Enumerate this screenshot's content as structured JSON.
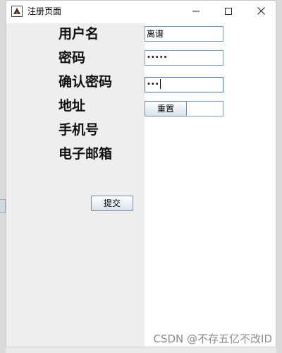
{
  "window": {
    "title": "注册页面",
    "icon": "java-app-icon",
    "controls": {
      "minimize": "minimize-icon",
      "maximize": "maximize-icon",
      "close": "close-icon"
    }
  },
  "form": {
    "labels": {
      "username": "用户名",
      "password": "密码",
      "confirm_password": "确认密码",
      "address": "地址",
      "phone": "手机号",
      "email": "电子邮箱"
    },
    "fields": {
      "username": "离谱",
      "password": "•••••",
      "confirm_password": "•••"
    },
    "buttons": {
      "reset": "重置",
      "submit": "提交"
    }
  },
  "watermark": "CSDN @不存五亿不改ID"
}
